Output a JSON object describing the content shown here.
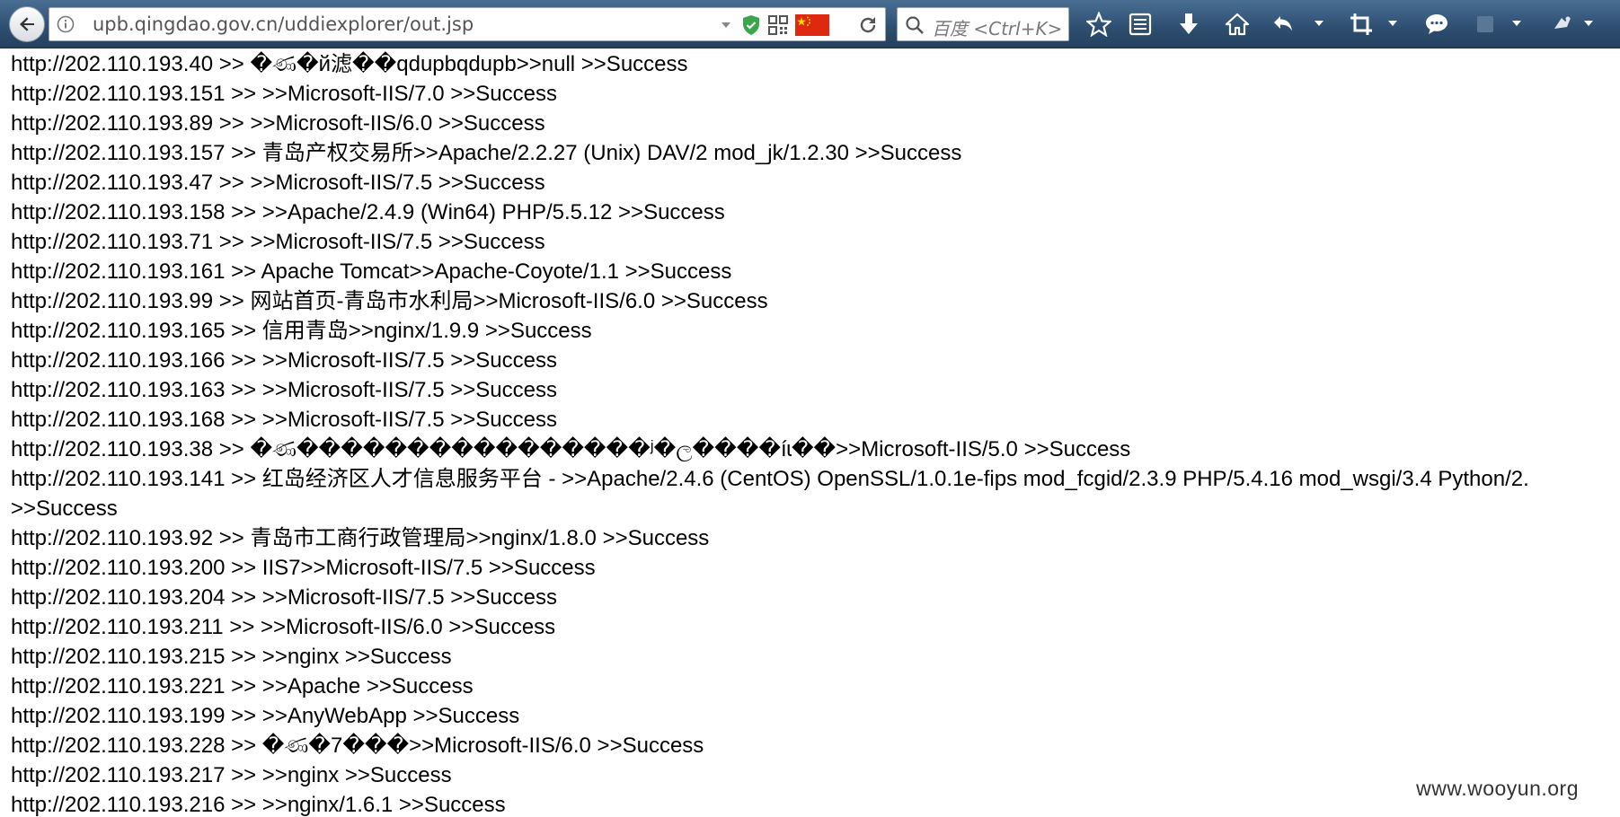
{
  "toolbar": {
    "url": "upb.qingdao.gov.cn/uddiexplorer/out.jsp",
    "search_placeholder": "百度 <Ctrl+K>"
  },
  "lines": [
    "http://202.110.193.40 >> �ණ�й滤��qdupbqdupb>>null >>Success",
    "http://202.110.193.151 >> >>Microsoft-IIS/7.0 >>Success",
    "http://202.110.193.89 >> >>Microsoft-IIS/6.0 >>Success",
    "http://202.110.193.157 >> 青岛产权交易所>>Apache/2.2.27 (Unix) DAV/2 mod_jk/1.2.30 >>Success",
    "http://202.110.193.47 >> >>Microsoft-IIS/7.5 >>Success",
    "http://202.110.193.158 >> >>Apache/2.4.9 (Win64) PHP/5.5.12 >>Success",
    "http://202.110.193.71 >> >>Microsoft-IIS/7.5 >>Success",
    "http://202.110.193.161 >> Apache Tomcat>>Apache-Coyote/1.1 >>Success",
    "http://202.110.193.99 >> 网站首页-青岛市水利局>>Microsoft-IIS/6.0 >>Success",
    "http://202.110.193.165 >> 信用青岛>>nginx/1.9.9 >>Success",
    "http://202.110.193.166 >> >>Microsoft-IIS/7.5 >>Success",
    "http://202.110.193.163 >> >>Microsoft-IIS/7.5 >>Success",
    "http://202.110.193.168 >> >>Microsoft-IIS/7.5 >>Success",
    "http://202.110.193.38 >> �ණ����������������ʲ�ල����íɩ��>>Microsoft-IIS/5.0 >>Success",
    "http://202.110.193.141 >> 红岛经济区人才信息服务平台 - >>Apache/2.4.6 (CentOS) OpenSSL/1.0.1e-fips mod_fcgid/2.3.9 PHP/5.4.16 mod_wsgi/3.4 Python/2.",
    ">>Success",
    "http://202.110.193.92 >> 青岛市工商行政管理局>>nginx/1.8.0 >>Success",
    "http://202.110.193.200 >> IIS7>>Microsoft-IIS/7.5 >>Success",
    "http://202.110.193.204 >> >>Microsoft-IIS/7.5 >>Success",
    "http://202.110.193.211 >> >>Microsoft-IIS/6.0 >>Success",
    "http://202.110.193.215 >> >>nginx >>Success",
    "http://202.110.193.221 >> >>Apache >>Success",
    "http://202.110.193.199 >> >>AnyWebApp >>Success",
    "http://202.110.193.228 >> �ණ�7���>>Microsoft-IIS/6.0 >>Success",
    "http://202.110.193.217 >> >>nginx >>Success",
    "http://202.110.193.216 >> >>nginx/1.6.1 >>Success"
  ],
  "watermark": "www.wooyun.org",
  "colors": {
    "toolbar_top": "#4a6f93",
    "toolbar_bottom": "#23415f",
    "shield": "#3aa54a",
    "flag_red": "#de2910",
    "flag_star": "#ffde00"
  }
}
